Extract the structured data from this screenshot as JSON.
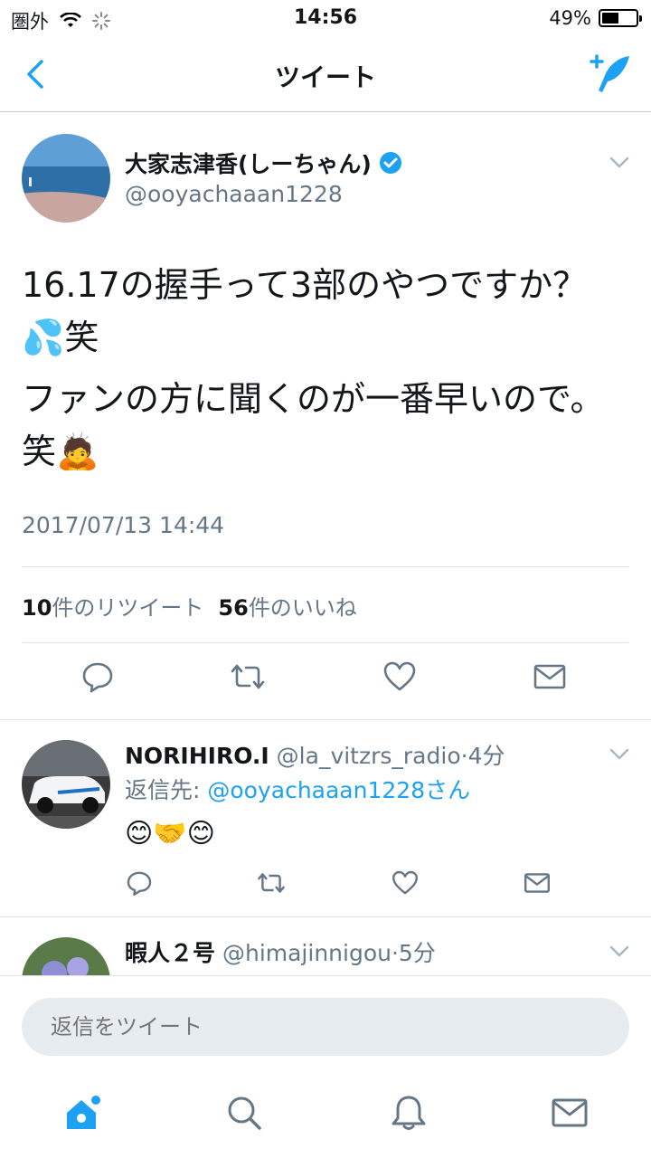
{
  "status_bar": {
    "carrier": "圏外",
    "time": "14:56",
    "battery_percent": "49%",
    "battery_level": 0.49
  },
  "nav": {
    "title": "ツイート"
  },
  "tweet": {
    "author_name": "大家志津香(しーちゃん)",
    "author_handle": "@ooyachaaan1228",
    "verified": true,
    "lines": [
      "16.17の握手って3部のやつですか？💦笑",
      "ファンの方に聞くのが一番早いので。笑🙇"
    ],
    "timestamp": "2017/07/13 14:44",
    "retweet_count": "10",
    "retweet_label": "件のリツイート",
    "like_count": "56",
    "like_label": "件のいいね"
  },
  "replies": [
    {
      "name": "NORIHIRO.I",
      "handle": "@la_vitzrs_radio",
      "age": "4分",
      "reply_to_label": "返信先: ",
      "reply_to_mention": "@ooyachaaan1228さん",
      "text": "😊🤝😊"
    },
    {
      "name": "暇人２号",
      "handle": "@himajinnigou",
      "age": "5分"
    }
  ],
  "compose": {
    "placeholder": "返信をツイート"
  },
  "colors": {
    "accent": "#1da1f2",
    "secondary_text": "#657786",
    "divider": "#dfe3e7"
  }
}
